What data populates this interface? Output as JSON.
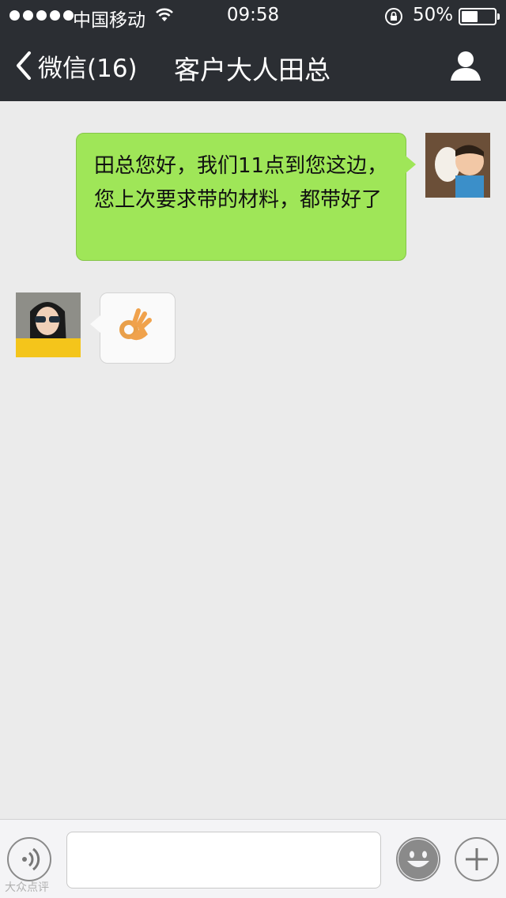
{
  "status_bar": {
    "carrier": "中国移动",
    "time": "09:58",
    "battery": "50%",
    "battery_level": 0.5
  },
  "nav": {
    "back_label": "微信(16)",
    "title": "客户大人田总",
    "profile_icon": "person-icon"
  },
  "messages": [
    {
      "direction": "outgoing",
      "text": "田总您好，我们11点到您这边，您上次要求带的材料，都带好了"
    },
    {
      "direction": "incoming",
      "emoji": "ok-hand-emoji"
    }
  ],
  "input_bar": {
    "voice_icon": "voice-icon",
    "emoji_icon": "smiley-icon",
    "plus_icon": "plus-icon",
    "text_value": ""
  },
  "colors": {
    "nav_bg": "#2b2e33",
    "outgoing_bubble": "#9fe658",
    "chat_bg": "#ebebeb"
  },
  "watermark": "大众点评"
}
